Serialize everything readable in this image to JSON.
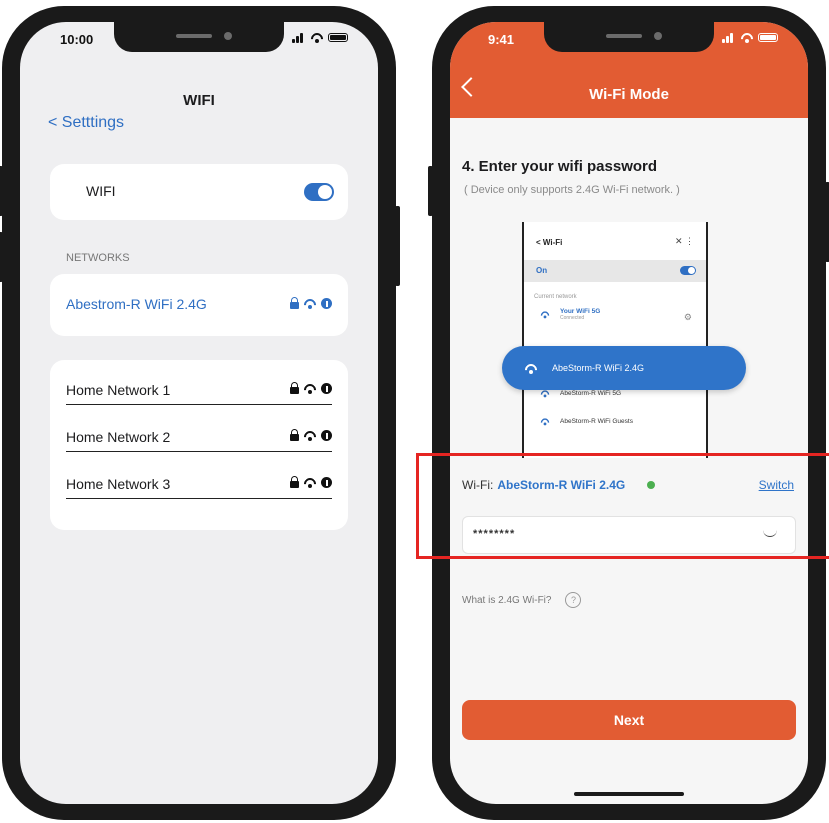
{
  "left_phone": {
    "status_time": "10:00",
    "title": "WIFI",
    "back_label": "< Setttings",
    "wifi_toggle_label": "WIFI",
    "wifi_on": true,
    "section_label": "NETWORKS",
    "connected_network": "Abestrom-R WiFi 2.4G",
    "networks": [
      "Home Network 1",
      "Home Network 2",
      "Home Network 3"
    ]
  },
  "right_phone": {
    "status_time": "9:41",
    "title": "Wi-Fi Mode",
    "step_title": "4. Enter your wifi password",
    "step_subtitle": "( Device only supports 2.4G Wi-Fi network. )",
    "mini_screen": {
      "header": "Wi-Fi",
      "on_label": "On",
      "current_network_label": "Current network",
      "current_network": "Your WiFi 5G",
      "current_network_status": "Connected",
      "popup_network": "AbeStorm-R WiFi 2.4G",
      "list": [
        "AbeStorm-R WiFi 5G",
        "AbeStorm-R WiFi Guests"
      ]
    },
    "wifi_label": "Wi-Fi:",
    "wifi_name": "AbeStorm-R WiFi 2.4G",
    "switch_label": "Switch",
    "password_masked": "********",
    "help_text": "What is 2.4G Wi-Fi?",
    "help_icon": "?",
    "next_label": "Next"
  },
  "colors": {
    "accent_orange": "#e25c33",
    "ios_blue": "#2f6fc3",
    "highlight_red": "#e52522",
    "connected_green": "#4caf50"
  }
}
